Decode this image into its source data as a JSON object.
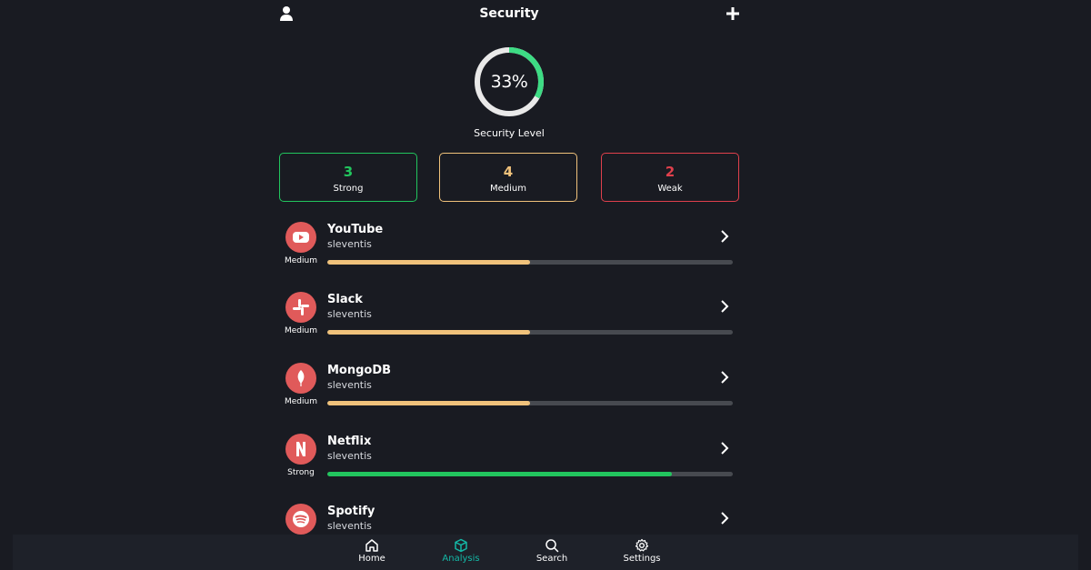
{
  "header": {
    "title": "Security",
    "user_icon": "user-icon",
    "add_icon": "plus-icon"
  },
  "gauge": {
    "percent": 33,
    "percent_text": "33%",
    "label": "Security Level",
    "color": "#3ddc84"
  },
  "stats": {
    "strong": {
      "count": "3",
      "label": "Strong",
      "color": "#22c55e"
    },
    "medium": {
      "count": "4",
      "label": "Medium",
      "color": "#f0c27b"
    },
    "weak": {
      "count": "2",
      "label": "Weak",
      "color": "#e0404c"
    }
  },
  "accounts": [
    {
      "name": "YouTube",
      "user": "sleventis",
      "strength": "Medium",
      "level": 0.5,
      "icon": "youtube-icon"
    },
    {
      "name": "Slack",
      "user": "sleventis",
      "strength": "Medium",
      "level": 0.5,
      "icon": "slack-icon"
    },
    {
      "name": "MongoDB",
      "user": "sleventis",
      "strength": "Medium",
      "level": 0.5,
      "icon": "mongodb-icon"
    },
    {
      "name": "Netflix",
      "user": "sleventis",
      "strength": "Strong",
      "level": 0.85,
      "icon": "netflix-icon"
    },
    {
      "name": "Spotify",
      "user": "sleventis",
      "strength": "",
      "level": null,
      "icon": "spotify-icon"
    }
  ],
  "nav": {
    "items": [
      {
        "label": "Home",
        "icon": "home-icon",
        "active": false
      },
      {
        "label": "Analysis",
        "icon": "cube-icon",
        "active": true
      },
      {
        "label": "Search",
        "icon": "search-icon",
        "active": false
      },
      {
        "label": "Settings",
        "icon": "gear-icon",
        "active": false
      }
    ]
  },
  "colors": {
    "background": "#191b22",
    "medium_bar": "#f0c27b",
    "strong_bar": "#22c55e",
    "track": "#474a50",
    "accent": "#14b8a6",
    "icon_bg": "#e05a5a"
  }
}
